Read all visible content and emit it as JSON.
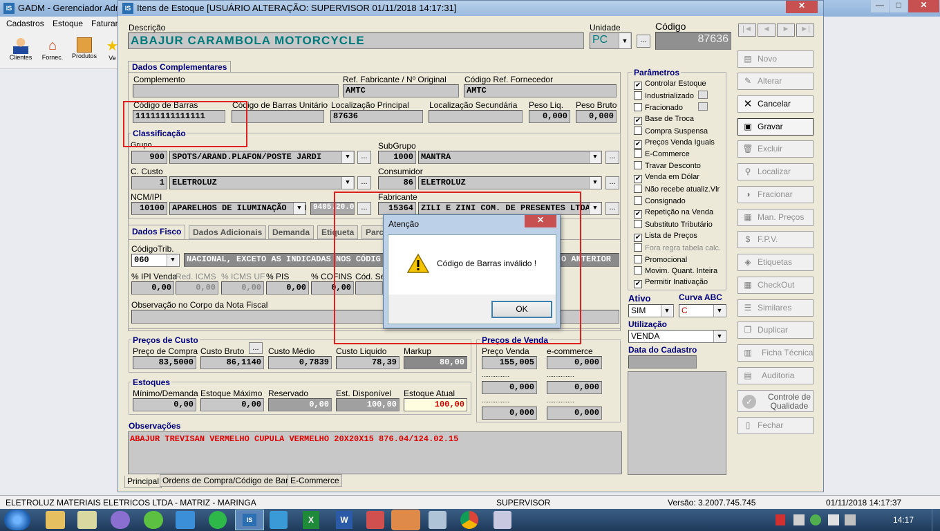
{
  "main_window": {
    "title": "GADM - Gerenciador Admi",
    "menu": [
      "Cadastros",
      "Estoque",
      "Faturan"
    ],
    "toolbar": [
      {
        "label": "Clientes",
        "icon": "person-icon"
      },
      {
        "label": "Fornec.",
        "icon": "house-icon"
      },
      {
        "label": "Produtos",
        "icon": "box-icon"
      },
      {
        "label": "Ve",
        "icon": "star-icon"
      }
    ]
  },
  "dialog": {
    "title": "Itens de Estoque  [USUÁRIO ALTERAÇÃO: SUPERVISOR 01/11/2018 14:17:31]"
  },
  "header": {
    "descricao_label": "Descrição",
    "descricao": "ABAJUR CARAMBOLA MOTORCYCLE",
    "unidade_label": "Unidade",
    "unidade": "PC",
    "codigo_label": "Código",
    "codigo": "87636",
    "ellipsis": "..."
  },
  "dados_compl": {
    "tab": "Dados Complementares",
    "complemento_label": "Complemento",
    "ref_fab_label": "Ref. Fabricante / Nº Original",
    "ref_fab": "AMTC",
    "cod_ref_label": "Código Ref. Fornecedor",
    "cod_ref": "AMTC",
    "cod_barras_label": "Código de Barras",
    "cod_barras": "11111111111111",
    "cod_barras_unit_label": "Código de Barras Unitário",
    "loc_princ_label": "Localização Principal",
    "loc_princ": "87636",
    "loc_sec_label": "Localização Secundária",
    "peso_liq_label": "Peso Liq.",
    "peso_liq": "0,000",
    "peso_bruto_label": "Peso Bruto",
    "peso_bruto": "0,000"
  },
  "classificacao": {
    "title": "Classificação",
    "grupo_label": "Grupo",
    "grupo_cod": "900",
    "grupo": "SPOTS/ARAND.PLAFON/POSTE JARDI",
    "subgrupo_label": "SubGrupo",
    "subgrupo_cod": "1000",
    "subgrupo": "MANTRA",
    "ccusto_label": "C. Custo",
    "ccusto_cod": "1",
    "ccusto": "ELETROLUZ",
    "consumidor_label": "Consumidor",
    "consumidor_cod": "86",
    "consumidor": "ELETROLUZ",
    "ncm_label": "NCM/IPI",
    "ncm_cod": "10100",
    "ncm": "APARELHOS DE ILUMINAÇÃO (INC",
    "ncm_num": "9405.20.00",
    "fabricante_label": "Fabricante",
    "fabricante_cod": "15364",
    "fabricante": "ZILI E ZINI COM. DE PRESENTES LTDA"
  },
  "fisco_tabs": [
    "Dados Fisco",
    "Dados Adicionais",
    "Demanda",
    "Etiqueta",
    "Parc"
  ],
  "fisco": {
    "codtrib_label": "CódigoTrib.",
    "codtrib": "060",
    "codtrib_desc_left": "NACIONAL, EXCETO AS INDICADAS NOS CÓDIG",
    "codtrib_desc_right": "O ANTERIOR",
    "ipi_label": "% IPI Venda",
    "ipi": "0,00",
    "red_icms_label": "Red. ICMS",
    "red_icms": "0,00",
    "icms_uf_label": "% ICMS UF",
    "icms_uf": "0,00",
    "pis_label": "% PIS",
    "pis": "0,00",
    "cofins_label": "% COFINS",
    "cofins": "0,00",
    "cod_serv_label": "Cód. Se",
    "obs_nf_label": "Observação no Corpo da Nota Fiscal"
  },
  "precos_custo": {
    "title": "Preços de Custo",
    "compra_label": "Preço de Compra",
    "compra": "83,5000",
    "bruto_label": "Custo Bruto",
    "bruto": "86,1140",
    "medio_label": "Custo Médio",
    "medio": "0,7839",
    "liquido_label": "Custo Liquido",
    "liquido": "78,39",
    "markup_label": "Markup",
    "markup": "80,00"
  },
  "estoques": {
    "title": "Estoques",
    "min_label": "Mínimo/Demanda",
    "min": "0,00",
    "max_label": "Estoque Máximo",
    "max": "0,00",
    "res_label": "Reservado",
    "res": "0,00",
    "disp_label": "Est. Disponível",
    "disp": "100,00",
    "atual_label": "Estoque Atual",
    "atual": "100,00"
  },
  "precos_venda": {
    "title": "Preços de Venda",
    "venda_label": "Preço Venda",
    "venda": "155,005",
    "ecom_label": "e-commerce",
    "ecom": "0,000",
    "dots": "................",
    "v2": "0,000",
    "v3": "0,000",
    "v4": "0,000",
    "v5": "0,000"
  },
  "observacoes": {
    "title": "Observações",
    "text": "ABAJUR TREVISAN VERMELHO CUPULA VERMELHO 20X20X15 876.04/124.02.15"
  },
  "parametros": {
    "title": "Parâmetros",
    "items": [
      {
        "label": "Controlar Estoque",
        "checked": true
      },
      {
        "label": "Industrializado",
        "checked": false
      },
      {
        "label": "Fracionado",
        "checked": false
      },
      {
        "label": "Base de Troca",
        "checked": true
      },
      {
        "label": "Compra Suspensa",
        "checked": false
      },
      {
        "label": "Preços Venda Iguais",
        "checked": true
      },
      {
        "label": "E-Commerce",
        "checked": false
      },
      {
        "label": "Travar Desconto",
        "checked": false
      },
      {
        "label": "Venda em Dólar",
        "checked": true
      },
      {
        "label": "Não recebe atualiz.Vlr",
        "checked": false
      },
      {
        "label": "Consignado",
        "checked": false
      },
      {
        "label": "Repetição na Venda",
        "checked": true
      },
      {
        "label": "Substituto Tributário",
        "checked": false
      },
      {
        "label": "Lista de Preços",
        "checked": true
      },
      {
        "label": "Fora regra tabela calc.",
        "checked": false
      },
      {
        "label": "Promocional",
        "checked": false
      },
      {
        "label": "Movim. Quant. Inteira",
        "checked": false
      },
      {
        "label": "Permitir Inativação",
        "checked": true
      }
    ]
  },
  "ativo": {
    "label": "Ativo",
    "value": "SIM",
    "curva_label": "Curva ABC",
    "curva": "C",
    "utilizacao_label": "Utilização",
    "utilizacao": "VENDA",
    "data_label": "Data do Cadastro"
  },
  "buttons": [
    "Novo",
    "Alterar",
    "Cancelar",
    "Gravar",
    "Excluir",
    "Localizar",
    "Fracionar",
    "Man. Preços",
    "F.P.V.",
    "Etiquetas",
    "CheckOut",
    "Similares",
    "Duplicar",
    "Ficha Técnica",
    "Auditoria",
    "Controle de Qualidade",
    "Fechar"
  ],
  "bottom_tabs": [
    "Principal",
    "Ordens de Compra/Código de Barras",
    "E-Commerce"
  ],
  "alert": {
    "title": "Atenção",
    "message": "Código de Barras inválido !",
    "ok": "OK"
  },
  "status": {
    "empresa": "ELETROLUZ MATERIAIS ELETRICOS LTDA  -  MATRIZ - MARINGA",
    "usuario": "SUPERVISOR",
    "versao": "Versão: 3.2007.745.745",
    "datahora": "01/11/2018 14:17:37"
  },
  "taskbar": {
    "clock": "14:17"
  },
  "colors": {
    "accent": "#000080",
    "title_active": "#2a6fb0",
    "error_red": "#e02020"
  }
}
